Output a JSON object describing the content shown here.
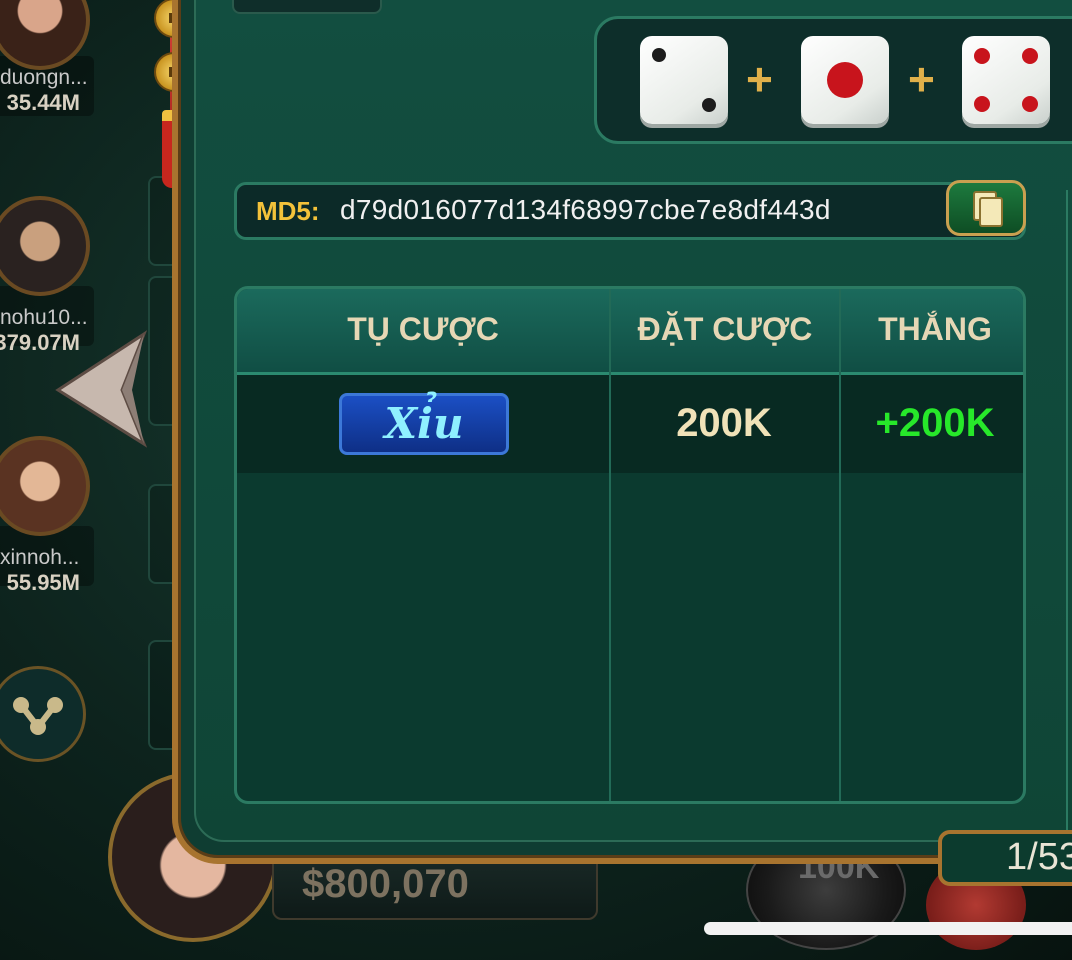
{
  "players": [
    {
      "name": "duongn...",
      "money": "35.44M"
    },
    {
      "name": "nohu10...",
      "money": "379.07M"
    },
    {
      "name": "xinnoh...",
      "money": "55.95M"
    }
  ],
  "md5": {
    "label": "MD5:",
    "value": "d79d016077d134f68997cbe7e8df443d"
  },
  "dice": [
    2,
    1,
    4
  ],
  "table": {
    "headers": [
      "TỤ CƯỢC",
      "ĐẶT CƯỢC",
      "THẮNG"
    ],
    "rows": [
      {
        "door": "Xỉu",
        "bet": "200K",
        "win": "+200K"
      }
    ]
  },
  "footer": {
    "balance": "$800,070",
    "chip_label": "100K",
    "page": "1/53"
  },
  "colors": {
    "gold": "#a8742f",
    "md5_label": "#f3c23a",
    "win_green": "#27e82a",
    "panel_green": "#0f3d32"
  }
}
